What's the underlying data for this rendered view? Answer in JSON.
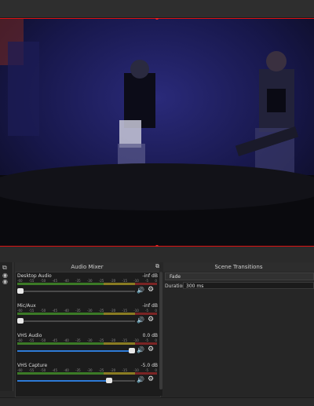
{
  "audio_mixer": {
    "title": "Audio Mixer",
    "channels": [
      {
        "name": "Desktop Audio",
        "db": "-inf dB",
        "volume_fraction": 0.0,
        "meter_level": 0.0
      },
      {
        "name": "Mic/Aux",
        "db": "-inf dB",
        "volume_fraction": 0.0,
        "meter_level": 0.0
      },
      {
        "name": "VHS Audio",
        "db": "0.0 dB",
        "volume_fraction": 1.0,
        "meter_level": 0.9
      },
      {
        "name": "VHS Capture",
        "db": "-5.0 dB",
        "volume_fraction": 0.78,
        "meter_level": 0.0
      }
    ],
    "tick_labels": [
      "-60",
      "-55",
      "-50",
      "-45",
      "-40",
      "-35",
      "-30",
      "-25",
      "-20",
      "-15",
      "-10",
      "-5",
      "0"
    ]
  },
  "scene_transitions": {
    "title": "Scene Transitions",
    "selected": "Fade",
    "duration_label": "Duration",
    "duration_value": "300 ms"
  },
  "icons": {
    "volume": "speaker-icon",
    "settings": "gear-icon",
    "float": "float-dock-icon"
  },
  "colors": {
    "selection": "#dd1111",
    "slider_fill": "#2d7ad6",
    "meter_green": "#3b7a26",
    "meter_yellow": "#8a7c22",
    "meter_red": "#7a2424"
  }
}
